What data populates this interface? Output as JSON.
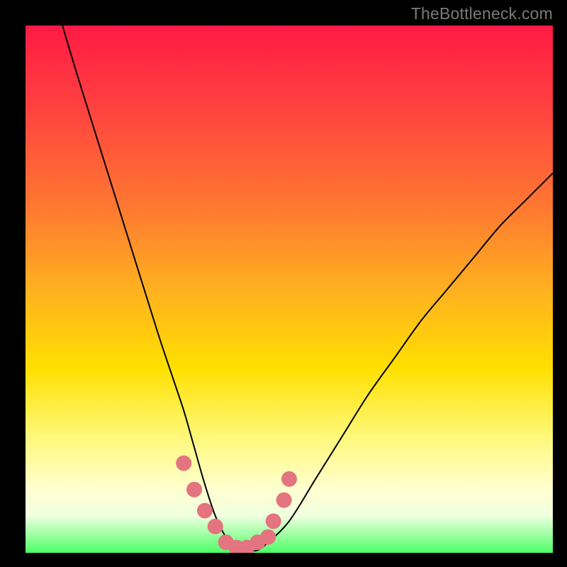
{
  "watermark": "TheBottleneck.com",
  "chart_data": {
    "type": "line",
    "title": "",
    "xlabel": "",
    "ylabel": "",
    "xlim": [
      0,
      100
    ],
    "ylim": [
      0,
      100
    ],
    "series": [
      {
        "name": "curve",
        "x": [
          7,
          10,
          15,
          20,
          25,
          28,
          30,
          32,
          34,
          36,
          38,
          40,
          42,
          44,
          46,
          50,
          55,
          60,
          65,
          70,
          75,
          80,
          85,
          90,
          95,
          100
        ],
        "y": [
          100,
          90,
          74,
          58,
          42,
          33,
          27,
          20,
          13,
          7,
          3,
          1,
          0.5,
          0.5,
          2,
          6,
          14,
          22,
          30,
          37,
          44,
          50,
          56,
          62,
          67,
          72
        ]
      }
    ],
    "highlight_points": {
      "name": "pink-dots",
      "color": "#e4747f",
      "x": [
        30,
        32,
        34,
        36,
        38,
        40,
        42,
        44,
        46,
        47,
        49,
        50
      ],
      "y": [
        17,
        12,
        8,
        5,
        2,
        1,
        1,
        2,
        3,
        6,
        10,
        14
      ]
    },
    "background_gradient": {
      "top": "#ff1a44",
      "mid": "#ffe000",
      "bottom": "#4cff66"
    }
  }
}
